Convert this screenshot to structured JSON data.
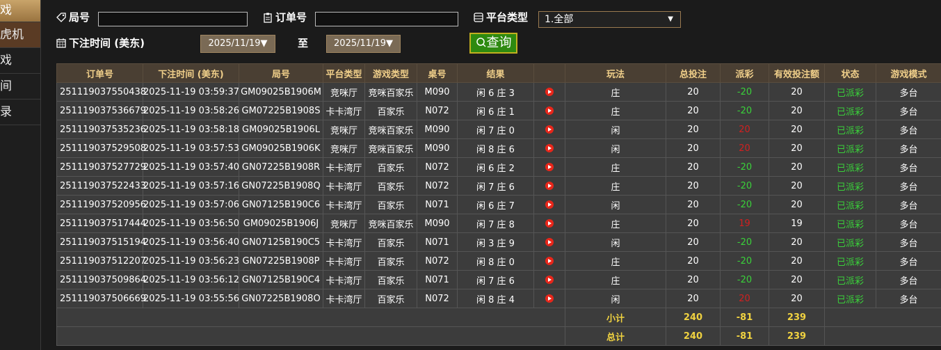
{
  "sidebar": {
    "items": [
      {
        "label": "戏",
        "state": "active"
      },
      {
        "label": "虎机",
        "state": "highlight"
      },
      {
        "label": "戏",
        "state": "normal"
      },
      {
        "label": "间",
        "state": "normal"
      },
      {
        "label": "录",
        "state": "normal"
      }
    ]
  },
  "filters": {
    "round_label": "局号",
    "round_value": "",
    "order_label": "订单号",
    "order_value": "",
    "platform_label": "平台类型",
    "platform_selected": "1.全部",
    "time_label": "下注时间 (美东)",
    "date_from": "2025/11/19▼",
    "to_label": "至",
    "date_to": "2025/11/19▼",
    "query_button": "查询"
  },
  "table": {
    "columns": [
      "订单号",
      "下注时间 (美东)",
      "局号",
      "平台类型",
      "游戏类型",
      "桌号",
      "结果",
      "",
      "玩法",
      "总投注",
      "派彩",
      "有效投注额",
      "状态",
      "游戏模式"
    ],
    "rows": [
      [
        "251119037550438",
        "2025-11-19 03:59:37",
        "GM09025B1906M",
        "竞咪厅",
        "竞咪百家乐",
        "M090",
        "闲 6 庄 3",
        "庄",
        "20",
        "-20",
        "20",
        "已派彩",
        "多台"
      ],
      [
        "251119037536679",
        "2025-11-19 03:58:26",
        "GM07225B1908S",
        "卡卡湾厅",
        "百家乐",
        "N072",
        "闲 6 庄 1",
        "庄",
        "20",
        "-20",
        "20",
        "已派彩",
        "多台"
      ],
      [
        "251119037535236",
        "2025-11-19 03:58:18",
        "GM09025B1906L",
        "竞咪厅",
        "竞咪百家乐",
        "M090",
        "闲 7 庄 0",
        "闲",
        "20",
        "20",
        "20",
        "已派彩",
        "多台"
      ],
      [
        "251119037529508",
        "2025-11-19 03:57:53",
        "GM09025B1906K",
        "竞咪厅",
        "竞咪百家乐",
        "M090",
        "闲 8 庄 6",
        "闲",
        "20",
        "20",
        "20",
        "已派彩",
        "多台"
      ],
      [
        "251119037527729",
        "2025-11-19 03:57:40",
        "GN07225B1908R",
        "卡卡湾厅",
        "百家乐",
        "N072",
        "闲 6 庄 2",
        "庄",
        "20",
        "-20",
        "20",
        "已派彩",
        "多台"
      ],
      [
        "251119037522433",
        "2025-11-19 03:57:16",
        "GN07225B1908Q",
        "卡卡湾厅",
        "百家乐",
        "N072",
        "闲 7 庄 6",
        "庄",
        "20",
        "-20",
        "20",
        "已派彩",
        "多台"
      ],
      [
        "251119037520956",
        "2025-11-19 03:57:06",
        "GN07125B190C6",
        "卡卡湾厅",
        "百家乐",
        "N071",
        "闲 6 庄 7",
        "闲",
        "20",
        "-20",
        "20",
        "已派彩",
        "多台"
      ],
      [
        "251119037517444",
        "2025-11-19 03:56:50",
        "GM09025B1906J",
        "竞咪厅",
        "竞咪百家乐",
        "M090",
        "闲 7 庄 8",
        "庄",
        "20",
        "19",
        "19",
        "已派彩",
        "多台"
      ],
      [
        "251119037515194",
        "2025-11-19 03:56:40",
        "GN07125B190C5",
        "卡卡湾厅",
        "百家乐",
        "N071",
        "闲 3 庄 9",
        "闲",
        "20",
        "-20",
        "20",
        "已派彩",
        "多台"
      ],
      [
        "251119037512207",
        "2025-11-19 03:56:23",
        "GN07225B1908P",
        "卡卡湾厅",
        "百家乐",
        "N072",
        "闲 8 庄 0",
        "庄",
        "20",
        "-20",
        "20",
        "已派彩",
        "多台"
      ],
      [
        "251119037509864",
        "2025-11-19 03:56:12",
        "GN07125B190C4",
        "卡卡湾厅",
        "百家乐",
        "N071",
        "闲 7 庄 6",
        "庄",
        "20",
        "-20",
        "20",
        "已派彩",
        "多台"
      ],
      [
        "251119037506669",
        "2025-11-19 03:55:56",
        "GN07225B1908O",
        "卡卡湾厅",
        "百家乐",
        "N072",
        "闲 8 庄 4",
        "闲",
        "20",
        "20",
        "20",
        "已派彩",
        "多台"
      ]
    ],
    "subtotal": {
      "label": "小计",
      "total_bet": "240",
      "payout": "-81",
      "valid_bet": "239"
    },
    "total": {
      "label": "总计",
      "total_bet": "240",
      "payout": "-81",
      "valid_bet": "239"
    }
  },
  "colors": {
    "header_bg": "#4a3f33",
    "header_text": "#f0cf8a",
    "negative": "#3ad13a",
    "positive": "#d22020",
    "status": "#3ad13a",
    "summary_text": "#f0d240",
    "query_button": "#2e8a10"
  },
  "icons": {
    "round": "tag-icon",
    "order": "clipboard-icon",
    "platform": "list-icon",
    "time": "calendar-icon",
    "query": "search-icon",
    "play": "play-icon"
  }
}
